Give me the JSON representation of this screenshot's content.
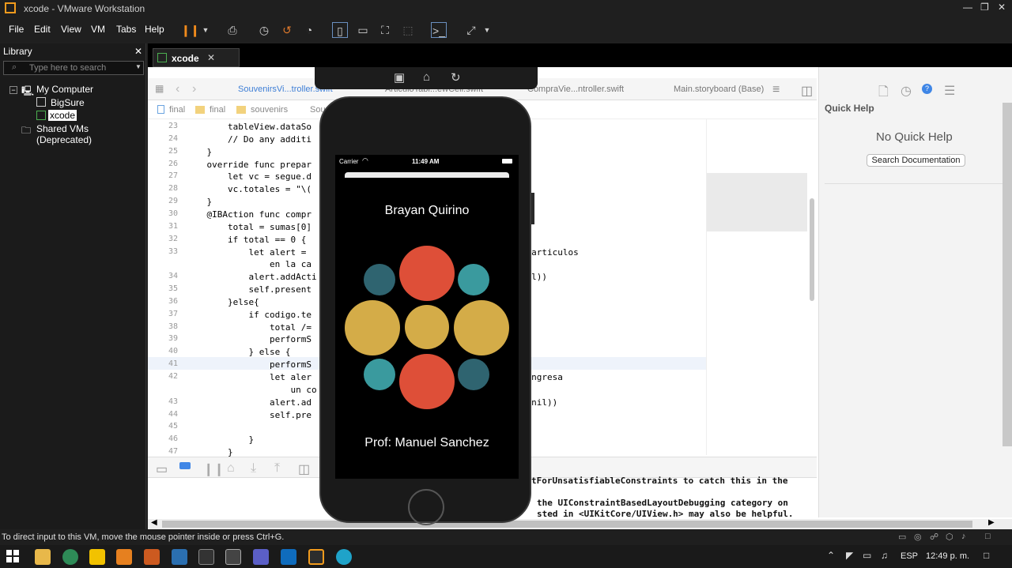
{
  "window": {
    "title": "xcode - VMware Workstation"
  },
  "menu": [
    "File",
    "Edit",
    "View",
    "VM",
    "Tabs",
    "Help"
  ],
  "library": {
    "header": "Library",
    "search_placeholder": "Type here to search",
    "items": [
      {
        "label": "My Computer"
      },
      {
        "label": "BigSure"
      },
      {
        "label": "xcode"
      },
      {
        "label": "Shared VMs (Deprecated)"
      }
    ]
  },
  "vm_tab": {
    "label": "xcode"
  },
  "xcode": {
    "tabs": [
      "SouvenirsVi...troller.swift",
      "ArticuloTabl...ewCell.swift",
      "CompraVie...ntroller.swift",
      "Main.storyboard (Base)"
    ],
    "breadcrumb": [
      "final",
      "final",
      "souvenirs",
      "Sou"
    ],
    "quick_help": {
      "title": "Quick Help",
      "empty": "No Quick Help",
      "search_button": "Search Documentation"
    },
    "code": [
      {
        "n": "23",
        "t": "        tableView.dataSo"
      },
      {
        "n": "24",
        "t": "        // Do any additi"
      },
      {
        "n": "25",
        "t": "    }"
      },
      {
        "n": "26",
        "t": "    override func prepar                              Any?) {"
      },
      {
        "n": "27",
        "t": "        let vc = segue.d"
      },
      {
        "n": "28",
        "t": "        vc.totales = \"\\("
      },
      {
        "n": "29",
        "t": "    }"
      },
      {
        "n": "30",
        "t": "    @IBAction func compr"
      },
      {
        "n": "31",
        "t": "        total = sumas[0]"
      },
      {
        "n": "32",
        "t": "        if total == 0 {"
      },
      {
        "n": "33",
        "t": "            let alert =                       \", message: \"No hay articulos"
      },
      {
        "n": "",
        "t": "                en la ca"
      },
      {
        "n": "34",
        "t": "            alert.addActi                     default, handler: nil))"
      },
      {
        "n": "35",
        "t": "            self.present                      )"
      },
      {
        "n": "36",
        "t": "        }else{"
      },
      {
        "n": "37",
        "t": "            if codigo.te"
      },
      {
        "n": "38",
        "t": "                total /="
      },
      {
        "n": "39",
        "t": "                performS                      : nil)"
      },
      {
        "n": "40",
        "t": "            } else {"
      },
      {
        "n": "41",
        "t": "                performS                      : nil)"
      },
      {
        "n": "42",
        "t": "                let aler                    correcto\", message: \"Ingresa"
      },
      {
        "n": "",
        "t": "                    un co"
      },
      {
        "n": "43",
        "t": "                alert.ad                    e: .default, handler: nil))"
      },
      {
        "n": "44",
        "t": "                self.pre                      nil)"
      },
      {
        "n": "45",
        "t": ""
      },
      {
        "n": "46",
        "t": "            }"
      },
      {
        "n": "47",
        "t": "        }"
      }
    ],
    "console": [
      "tForUnsatisfiableConstraints to catch this in the",
      "the UIConstraintBasedLayoutDebugging category on",
      "sted in <UIKitCore/UIView.h> may also be helpful."
    ]
  },
  "phone": {
    "carrier": "Carrier",
    "time": "11:49 AM",
    "name": "Brayan Quirino",
    "footer": "Prof: Manuel Sanchez"
  },
  "status": {
    "message": "To direct input to this VM, move the mouse pointer inside or press Ctrl+G."
  },
  "tray": {
    "lang": "ESP",
    "time": "12:49 p. m."
  },
  "colors": {
    "red": "#DE4F38",
    "teal_dark": "#2F6470",
    "teal": "#3A9A9E",
    "gold": "#D4AC48"
  }
}
